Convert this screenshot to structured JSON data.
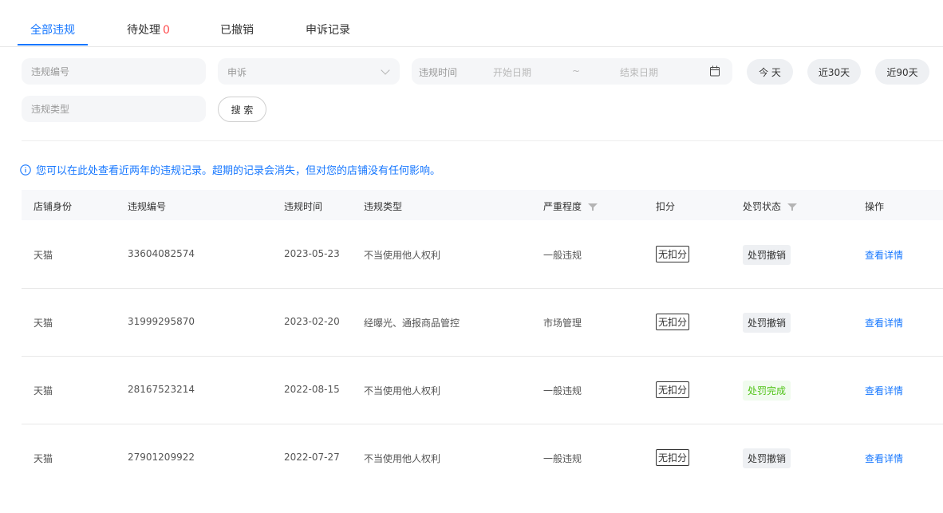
{
  "tabs": [
    {
      "label": "全部违规",
      "active": true
    },
    {
      "label": "待处理",
      "count": "0"
    },
    {
      "label": "已撤销"
    },
    {
      "label": "申诉记录"
    }
  ],
  "filters": {
    "violation_no_placeholder": "违规编号",
    "appeal_select": "申诉",
    "date_label": "违规时间",
    "start_placeholder": "开始日期",
    "separator": "~",
    "end_placeholder": "结束日期",
    "quick_ranges": [
      "今 天",
      "近30天",
      "近90天"
    ],
    "type_placeholder": "违规类型",
    "search_label": "搜 索"
  },
  "info_text": "您可以在此处查看近两年的违规记录。超期的记录会消失，但对您的店铺没有任何影响。",
  "table": {
    "headers": [
      "店铺身份",
      "违规编号",
      "违规时间",
      "违规类型",
      "严重程度",
      "扣分",
      "处罚状态",
      "操作"
    ],
    "rows": [
      {
        "shop": "天猫",
        "id": "33604082574",
        "date": "2023-05-23",
        "type": "不当使用他人权利",
        "severity": "一般违规",
        "points": "无扣分",
        "status": "处罚撤销",
        "status_kind": "revoked",
        "action": "查看详情"
      },
      {
        "shop": "天猫",
        "id": "31999295870",
        "date": "2023-02-20",
        "type": "经曝光、通报商品管控",
        "severity": "市场管理",
        "points": "无扣分",
        "status": "处罚撤销",
        "status_kind": "revoked",
        "action": "查看详情"
      },
      {
        "shop": "天猫",
        "id": "28167523214",
        "date": "2022-08-15",
        "type": "不当使用他人权利",
        "severity": "一般违规",
        "points": "无扣分",
        "status": "处罚完成",
        "status_kind": "done",
        "action": "查看详情"
      },
      {
        "shop": "天猫",
        "id": "27901209922",
        "date": "2022-07-27",
        "type": "不当使用他人权利",
        "severity": "一般违规",
        "points": "无扣分",
        "status": "处罚撤销",
        "status_kind": "revoked",
        "action": "查看详情"
      }
    ]
  },
  "colors": {
    "accent": "#1677ff",
    "danger": "#ff4d4f",
    "success": "#52c41a"
  }
}
